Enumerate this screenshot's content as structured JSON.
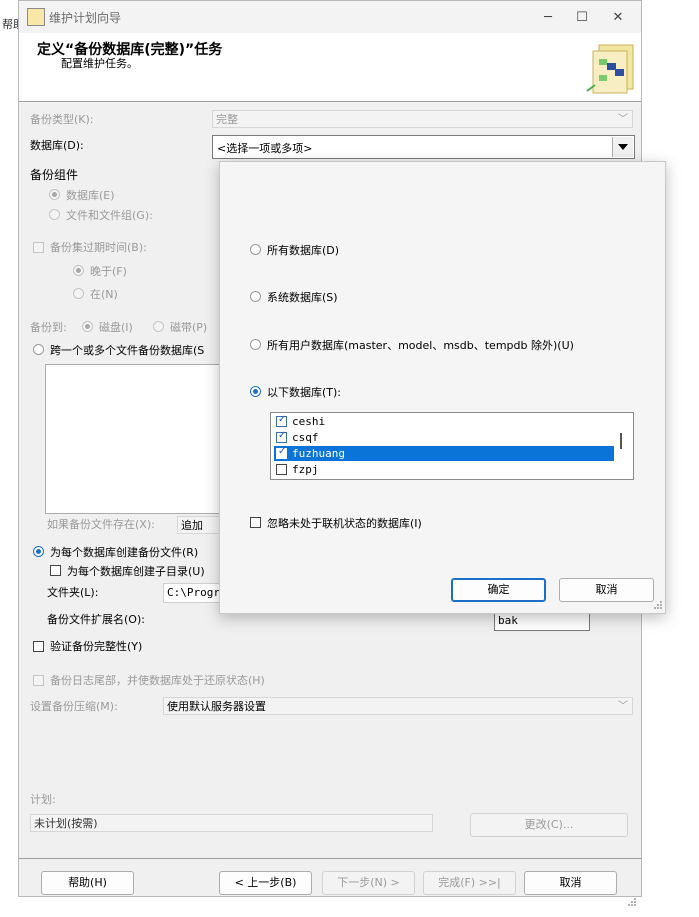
{
  "behind": {
    "menu_text": "帮助"
  },
  "window": {
    "title": "维护计划向导",
    "controls": {
      "minimize": "─",
      "maximize": "☐",
      "close": "✕"
    }
  },
  "header": {
    "title": "定义“备份数据库(完整)”任务",
    "subtitle": "配置维护任务。"
  },
  "form": {
    "backup_type_label": "备份类型(K):",
    "backup_type_value": "完整",
    "database_label": "数据库(D):",
    "database_value": "<选择一项或多项>",
    "component_label": "备份组件",
    "component_database": "数据库(E)",
    "component_files": "文件和文件组(G):",
    "expire_label": "备份集过期时间(B):",
    "expire_after": "晚于(F)",
    "expire_on": "在(N)",
    "backup_to_label": "备份到:",
    "backup_to_disk": "磁盘(I)",
    "backup_to_tape": "磁带(P)",
    "span_files": "跨一个或多个文件备份数据库(S",
    "if_exists_label": "如果备份文件存在(X):",
    "if_exists_value": "追加",
    "per_db_file": "为每个数据库创建备份文件(R)",
    "per_db_subdir": "为每个数据库创建子目录(U)",
    "folder_label": "文件夹(L):",
    "folder_value": "C:\\Progra",
    "ext_label": "备份文件扩展名(O):",
    "ext_value": "bak",
    "verify": "验证备份完整性(Y)",
    "tail_log": "备份日志尾部，并使数据库处于还原状态(H)",
    "compression_label": "设置备份压缩(M):",
    "compression_value": "使用默认服务器设置",
    "schedule_label": "计划:",
    "schedule_value": "未计划(按需)",
    "change_button": "更改(C)..."
  },
  "footer": {
    "help": "帮助(H)",
    "back": "< 上一步(B)",
    "next": "下一步(N) >",
    "finish": "完成(F) >>|",
    "cancel": "取消"
  },
  "popup": {
    "options": {
      "all": "所有数据库(D)",
      "system": "系统数据库(S)",
      "user": "所有用户数据库(master、model、msdb、tempdb 除外)(U)",
      "these": "以下数据库(T):"
    },
    "selected_option": "these",
    "databases": [
      {
        "name": "ceshi",
        "checked": true,
        "selected": false
      },
      {
        "name": "csqf",
        "checked": true,
        "selected": false
      },
      {
        "name": "fuzhuang",
        "checked": true,
        "selected": true
      },
      {
        "name": "fzpj",
        "checked": false,
        "selected": false
      }
    ],
    "ignore_offline": "忽略未处于联机状态的数据库(I)",
    "ok": "确定",
    "cancel": "取消"
  },
  "colors": {
    "selection": "#0a74d8",
    "accent": "#1a6fc7"
  }
}
